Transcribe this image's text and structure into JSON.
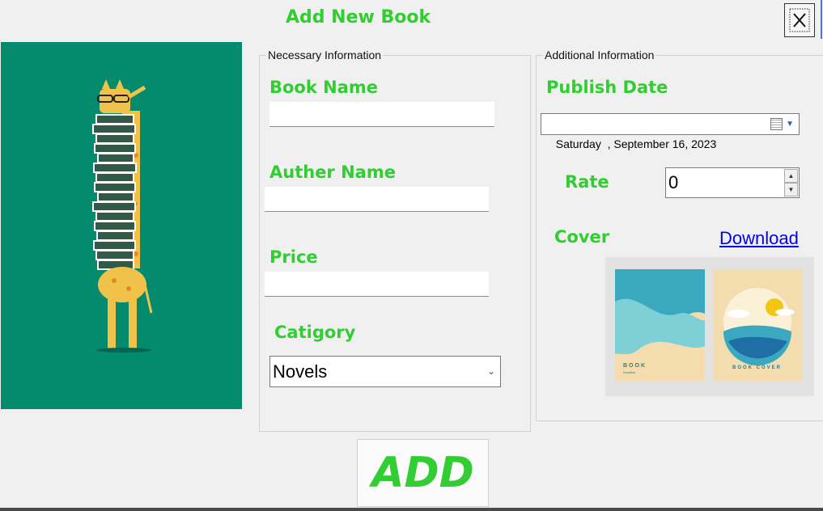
{
  "form": {
    "title": "Add New Book"
  },
  "necessary": {
    "legend": "Necessary Information",
    "book_name_label": "Book Name",
    "book_name_value": "",
    "author_label": "Auther Name",
    "author_value": "",
    "price_label": "Price",
    "price_value": "",
    "category_label": "Catigory",
    "category_selected": "Novels"
  },
  "additional": {
    "legend": "Additional Information",
    "publish_label": "Publish Date",
    "date_day": "Saturday",
    "date_rest": "  , September 16, 2023",
    "rate_label": "Rate",
    "rate_value": "0",
    "cover_label": "Cover",
    "download_link": "Download",
    "cover_left_title": "BOOK",
    "cover_left_sub": "headline",
    "cover_right_title": "BOOK COVER"
  },
  "actions": {
    "add_label": "ADD"
  },
  "colors": {
    "accent_green": "#32cd32",
    "panel_teal": "#048a6c",
    "link_blue": "#0000ee"
  }
}
